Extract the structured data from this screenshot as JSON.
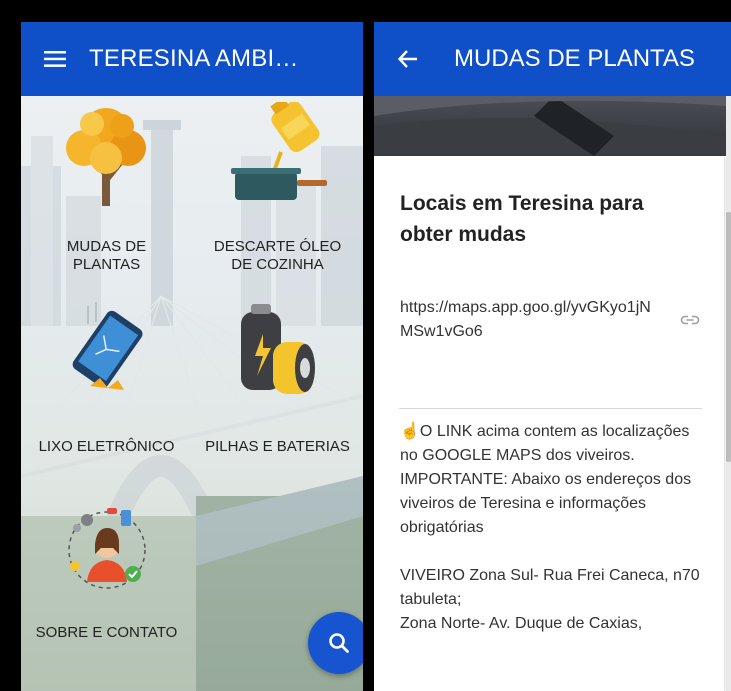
{
  "left": {
    "appbar": {
      "title": "TERESINA AMBI…",
      "menu_icon": "hamburger-menu-icon"
    },
    "tiles": [
      {
        "icon": "tree-icon",
        "label": "MUDAS DE\nPLANTAS"
      },
      {
        "icon": "cooking-oil-icon",
        "label": "DESCARTE ÓLEO\nDE COZINHA"
      },
      {
        "icon": "broken-phone-icon",
        "label": "LIXO ELETRÔNICO"
      },
      {
        "icon": "battery-icon",
        "label": "PILHAS E BATERIAS"
      },
      {
        "icon": "support-agent-icon",
        "label": "SOBRE E CONTATO"
      }
    ],
    "fab_icon": "search-icon"
  },
  "right": {
    "appbar": {
      "title": "MUDAS DE PLANTAS",
      "back_icon": "arrow-back-icon"
    },
    "card_title": "Locais em Teresina para obter mudas",
    "link": {
      "text": "https://maps.app.goo.gl/yvGKyo1jNMSw1vGo6",
      "icon": "link-icon"
    },
    "body": {
      "line1": "☝O LINK acima contem as localizações no GOOGLE MAPS dos viveiros.",
      "line2": "IMPORTANTE: Abaixo os endereços dos viveiros de Teresina e informações obrigatórias",
      "line3": "VIVEIRO Zona Sul- Rua Frei Caneca, n70 tabuleta;",
      "line4": "Zona Norte- Av. Duque de Caxias,"
    }
  },
  "colors": {
    "primary": "#0f4fc8",
    "fab": "#1655cf",
    "text": "#222222"
  }
}
